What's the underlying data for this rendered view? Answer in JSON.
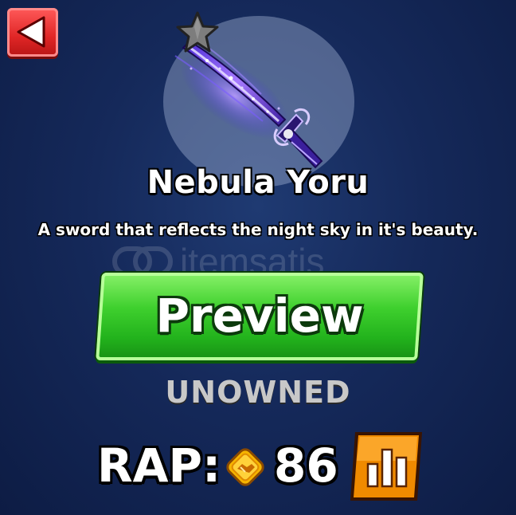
{
  "item": {
    "name": "Nebula Yoru",
    "description": "A sword that reflects the night sky in it's beauty.",
    "rarity_icon": "star-icon"
  },
  "actions": {
    "back_icon": "back-arrow-icon",
    "preview_label": "Preview",
    "stats_icon": "bar-chart-icon"
  },
  "status": {
    "ownership": "UNOWNED"
  },
  "rap": {
    "label": "RAP:",
    "value": "86",
    "currency_icon": "handshake-coin-icon"
  },
  "watermark": {
    "text": "itemsatis"
  },
  "colors": {
    "background": "#15295a",
    "preview_button": "#3fd02e",
    "back_button": "#e02626",
    "stats_button": "#f08a00",
    "coin": "#f7b500"
  }
}
